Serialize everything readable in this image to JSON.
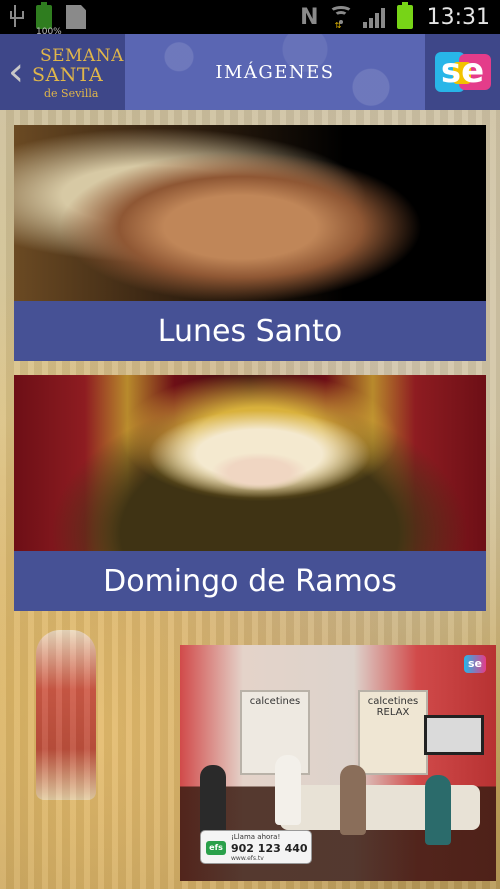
{
  "status_bar": {
    "battery_small_label": "100%",
    "network_letter": "N",
    "time": "13:31",
    "signal_bars": 4
  },
  "app_bar": {
    "back_label": "‹",
    "logo": {
      "line1": "SEMANA",
      "line2": "SANTA",
      "line3": "de Sevilla"
    },
    "title": "IMÁGENES",
    "brand_icon_text": "se"
  },
  "cards": [
    {
      "caption": "Lunes Santo"
    },
    {
      "caption": "Domingo de Ramos"
    }
  ],
  "ad": {
    "poster1_text": "calcetines",
    "poster2_text": "calcetines RELAX",
    "call_text": "¡Llama ahora!",
    "phone": "902 123 440",
    "site": "www.efs.tv",
    "efs_label": "efs",
    "badge": "se"
  },
  "colors": {
    "app_bar_blue": "#4a55a0",
    "caption_blue": "#4a56a0",
    "logo_gold": "#e0b64a",
    "battery_green": "#77d417"
  }
}
